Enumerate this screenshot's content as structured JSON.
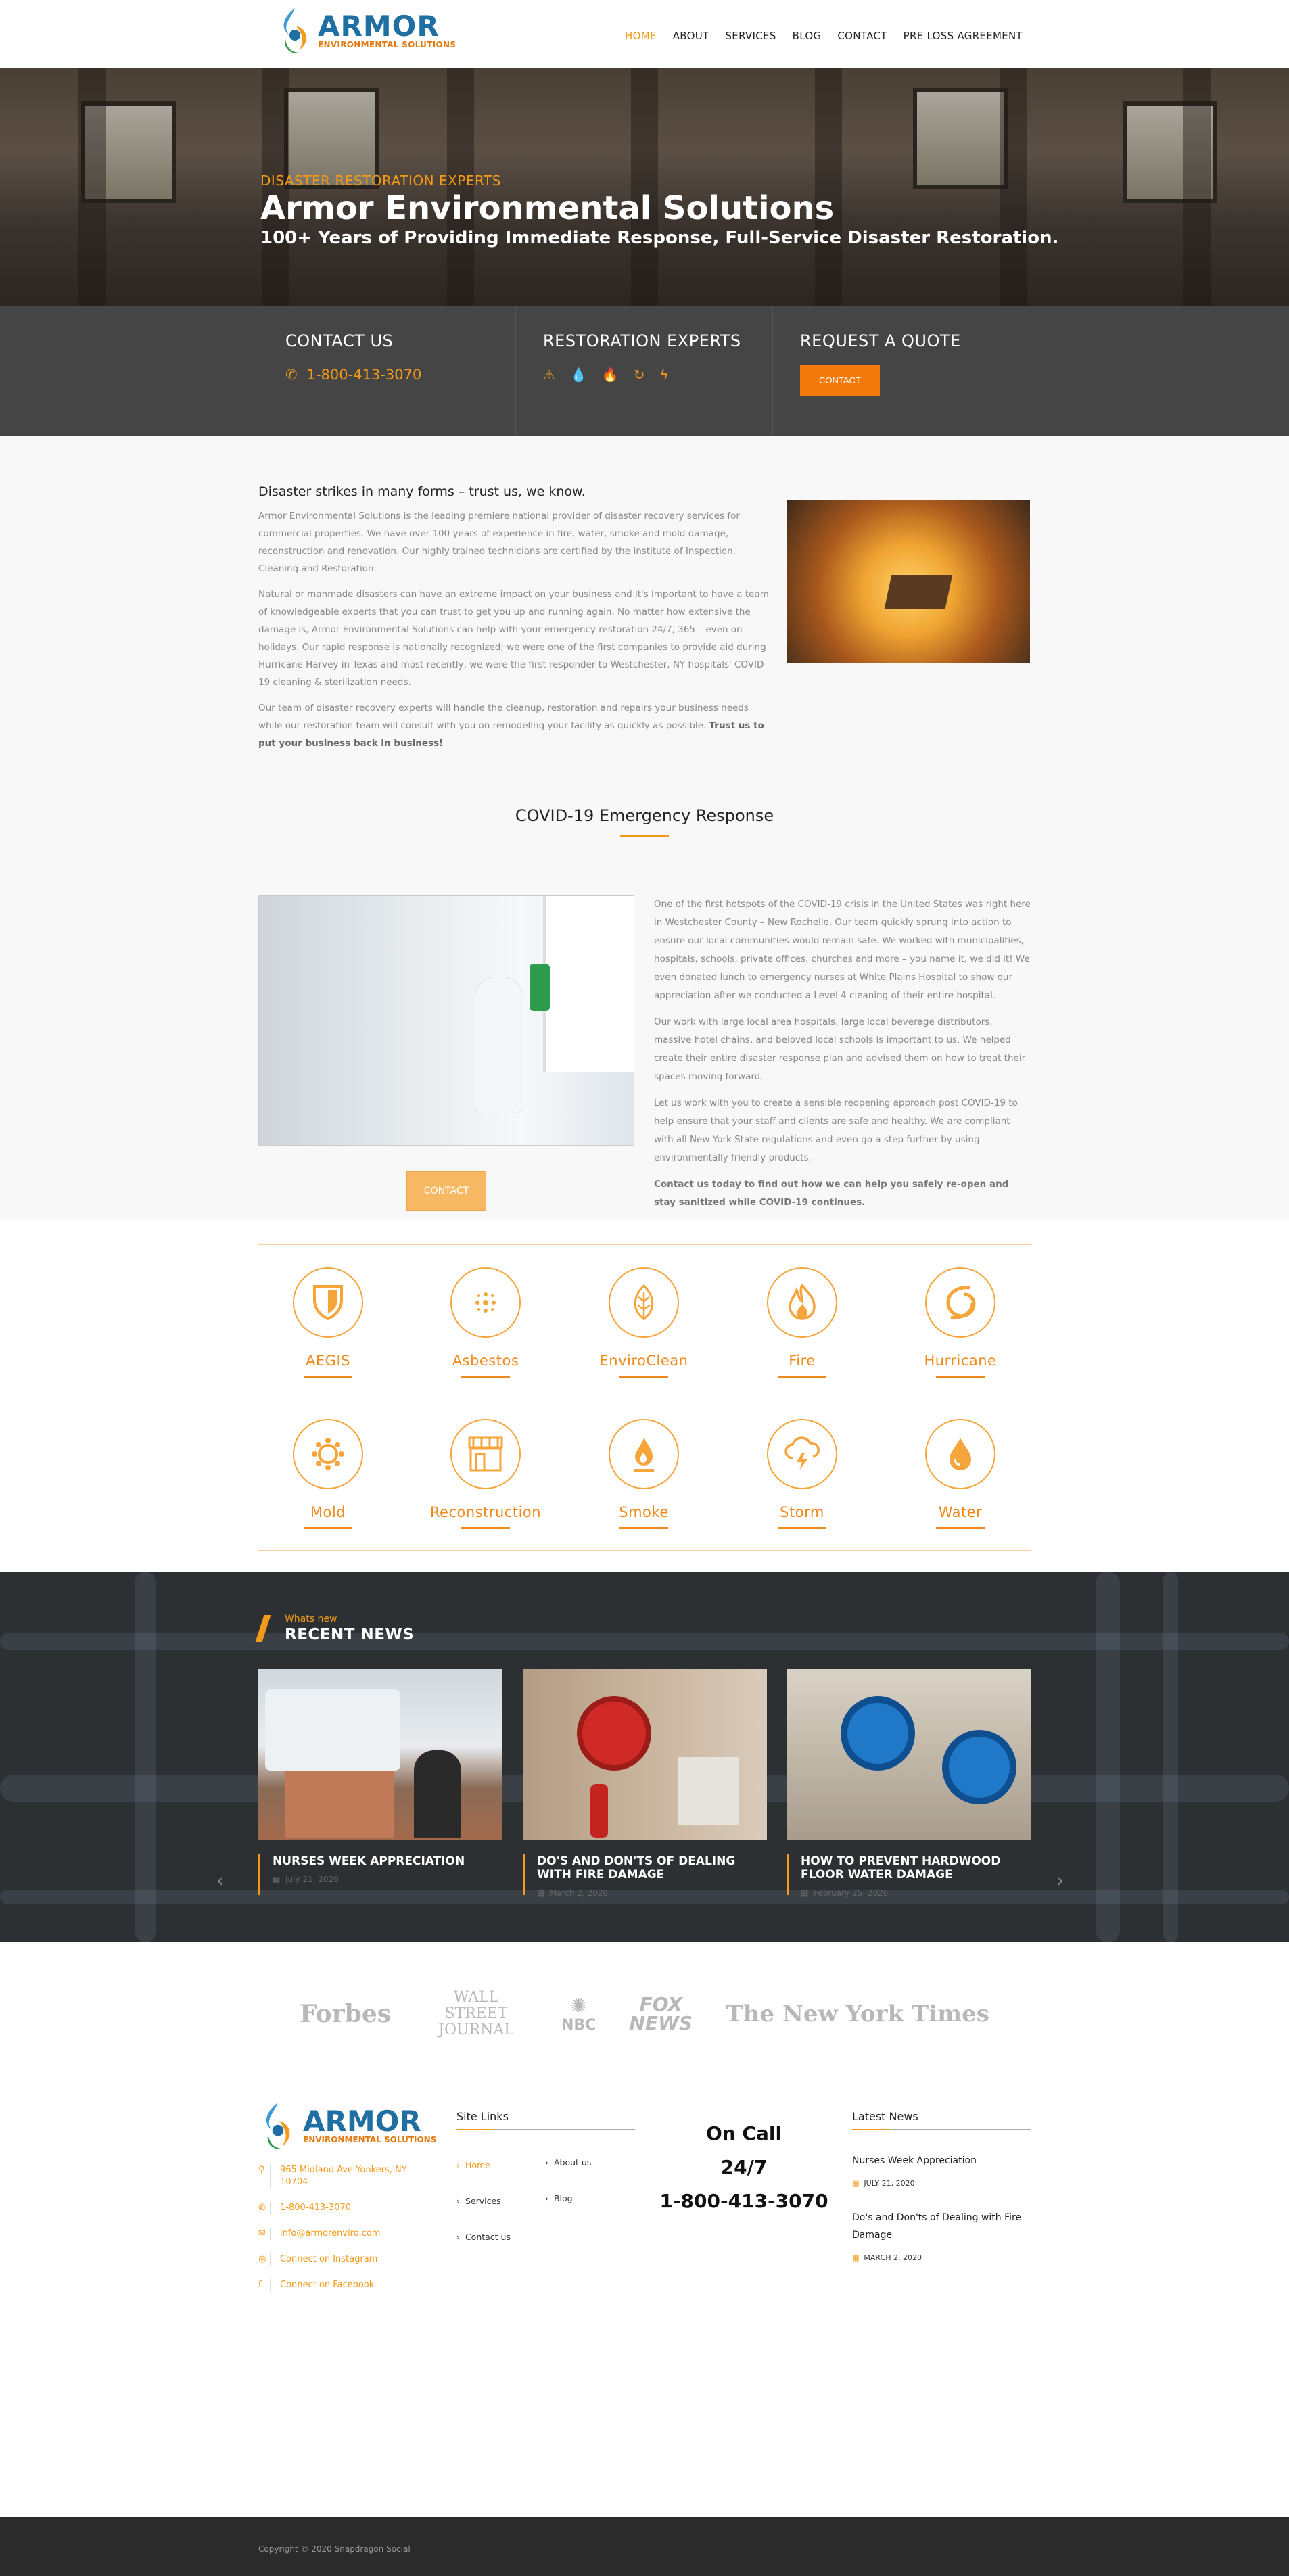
{
  "header": {
    "logo_name": "ARMOR",
    "logo_tag": "ENVIRONMENTAL SOLUTIONS",
    "nav": [
      "HOME",
      "ABOUT",
      "SERVICES",
      "BLOG",
      "CONTACT",
      "PRE LOSS AGREEMENT"
    ]
  },
  "hero": {
    "kicker": "DISASTER RESTORATION EXPERTS",
    "title": "Armor Environmental Solutions",
    "subtitle": "100+ Years of Providing Immediate Response, Full-Service Disaster Restoration."
  },
  "infobar": {
    "contact_title": "CONTACT US",
    "phone": "1-800-413-3070",
    "experts_title": "RESTORATION EXPERTS",
    "quote_title": "REQUEST A QUOTE",
    "quote_button": "CONTACT"
  },
  "about": {
    "heading": "Disaster strikes in many forms – trust us, we know.",
    "p1": "Armor Environmental Solutions is the leading premiere national provider of disaster recovery services for commercial properties. We have over 100 years of experience in fire, water, smoke and mold damage, reconstruction and renovation. Our highly trained technicians are certified by the Institute of Inspection, Cleaning and Restoration.",
    "p2": "Natural or manmade disasters can have an extreme impact on your business and it's important to have a team of knowledgeable experts that you can trust to get you up and running again. No matter how extensive the damage is, Armor Environmental Solutions can help with your emergency restoration 24/7, 365 – even on holidays. Our rapid response is nationally recognized; we were one of the first companies to provide aid during Hurricane Harvey in Texas and most recently, we were the first responder to Westchester, NY hospitals' COVID-19 cleaning & sterilization needs.",
    "p3": "Our team of disaster recovery experts will handle the cleanup, restoration and repairs your business needs while our restoration team will consult with you on remodeling your facility as quickly as possible.",
    "p3_bold": "Trust us to put your business back in business!"
  },
  "covid": {
    "heading": "COVID-19 Emergency Response",
    "p1": "One of the first hotspots of the COVID-19 crisis in the United States was right here in Westchester County – New Rochelle. Our team quickly sprung into action to ensure our local communities would remain safe. We worked with municipalities, hospitals, schools, private offices, churches and more – you name it, we did it! We even donated lunch to emergency nurses at White Plains Hospital to show our appreciation after we conducted a Level 4 cleaning of their entire hospital.",
    "p2": "Our work with large local area hospitals, large local beverage distributors, massive hotel chains, and beloved local schools is important to us. We helped create their entire disaster response plan and advised them on how to treat their spaces moving forward.",
    "p3": "Let us work with you to create a sensible reopening approach post COVID-19 to help ensure that your staff and clients are safe and healthy. We are compliant with all New York State regulations and even go a step further by using environmentally friendly products.",
    "p4": "Contact us today to find out how we can help you safely re-open and stay sanitized while COVID-19 continues.",
    "button": "CONTACT"
  },
  "services": [
    "AEGIS",
    "Asbestos",
    "EnviroClean",
    "Fire",
    "Hurricane",
    "Mold",
    "Reconstruction",
    "Smoke",
    "Storm",
    "Water"
  ],
  "news": {
    "kicker": "Whats new",
    "heading": "RECENT NEWS",
    "items": [
      {
        "title": "NURSES WEEK APPRECIATION",
        "date": "July 21, 2020"
      },
      {
        "title": "DO'S AND DON'TS OF DEALING WITH FIRE DAMAGE",
        "date": "March 2, 2020"
      },
      {
        "title": "HOW TO PREVENT HARDWOOD FLOOR WATER DAMAGE",
        "date": "February 25, 2020"
      }
    ]
  },
  "press": [
    "Forbes",
    "WALL STREET JOURNAL",
    "NBC",
    "FOX NEWS",
    "The New York Times"
  ],
  "footer": {
    "address": "965 Midland Ave Yonkers, NY 10704",
    "phone": "1-800-413-3070",
    "email": "info@armorenviro.com",
    "instagram": "Connect on Instagram",
    "facebook": "Connect on Facebook",
    "links_title": "Site Links",
    "links": [
      "Home",
      "About us",
      "Services",
      "Blog",
      "Contact us"
    ],
    "oncall1": "On Call",
    "oncall2": "24/7",
    "oncall3": "1-800-413-3070",
    "news_title": "Latest News",
    "news1": "Nurses Week Appreciation",
    "news1_date": "JULY 21, 2020",
    "news2": "Do's and Don'ts of Dealing with Fire Damage",
    "news2_date": "MARCH 2, 2020",
    "copyright": "Copyright © 2020 Snapdragon Social"
  }
}
